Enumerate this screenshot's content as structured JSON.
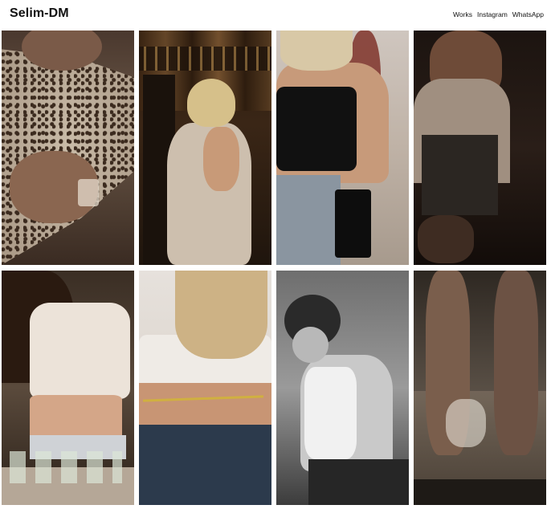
{
  "header": {
    "title": "Selim-DM",
    "nav": [
      "Works",
      "Instagram",
      "WhatsApp"
    ]
  },
  "gallery": {
    "photo_count": 8
  },
  "colors": {
    "background": "#ffffff",
    "text": "#111111"
  }
}
